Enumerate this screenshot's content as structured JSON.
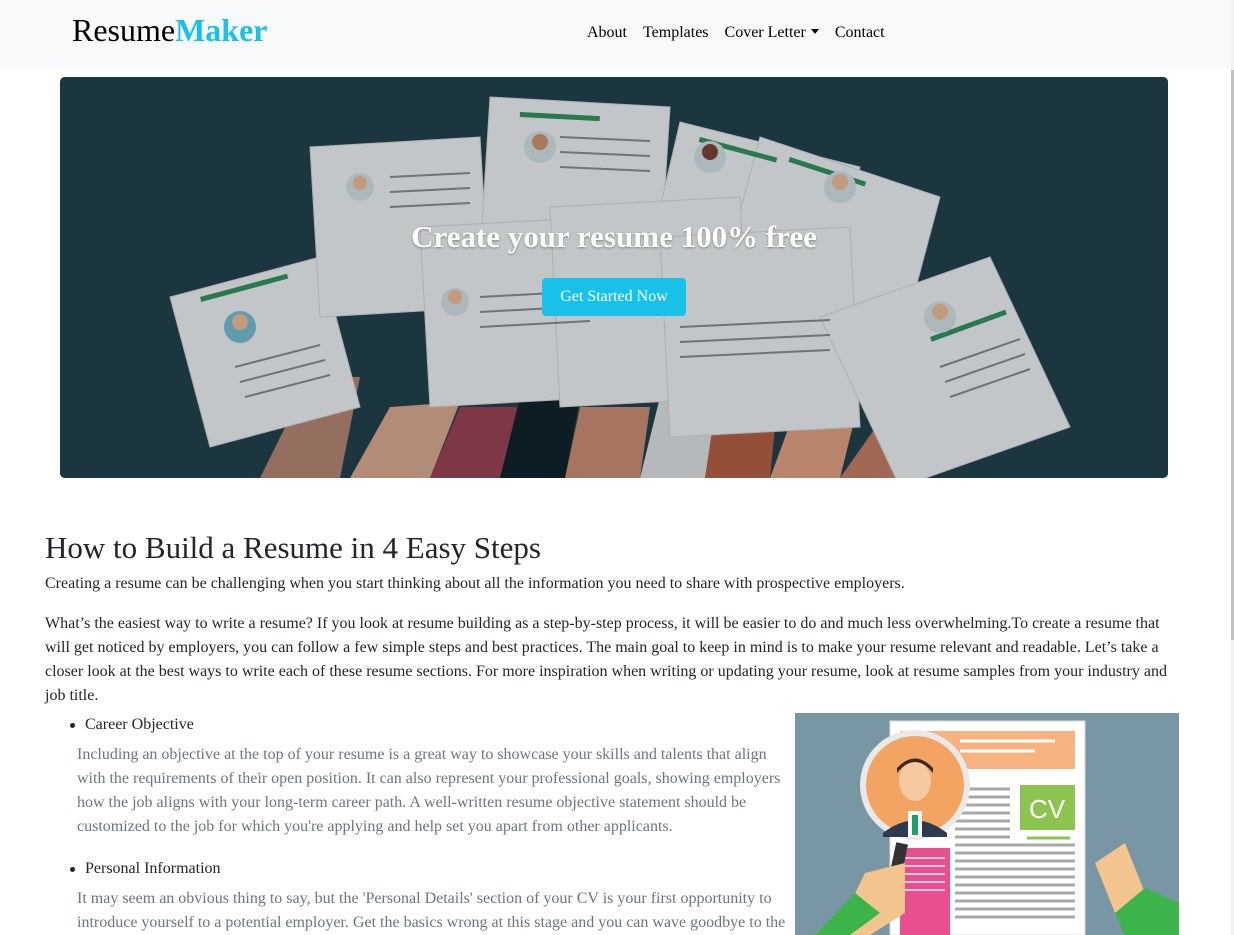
{
  "navbar": {
    "brand_part1": "Resume",
    "brand_part2": "Maker",
    "links": [
      {
        "label": "About"
      },
      {
        "label": "Templates"
      },
      {
        "label": "Cover Letter"
      },
      {
        "label": "Contact"
      }
    ],
    "brand_accent_color": "#17c1e8"
  },
  "hero": {
    "title": "Create your resume 100% free",
    "cta_label": "Get Started Now",
    "cta_color": "#17c1e8",
    "background_color": "#1e3a44"
  },
  "section": {
    "title": "How to Build a Resume in 4 Easy Steps",
    "intro": "Creating a resume can be challenging when you start thinking about all the information you need to share with prospective employers.",
    "body": "What’s the easiest way to write a resume? If you look at resume building as a step-by-step process, it will be easier to do and much less overwhelming.To create a resume that will get noticed by employers, you can follow a few simple steps and best practices. The main goal to keep in mind is to make your resume relevant and readable. Let’s take a closer look at the best ways to write each of these resume sections. For more inspiration when writing or updating your resume, look at resume samples from your industry and job title."
  },
  "steps": [
    {
      "title": "Career Objective",
      "text": "Including an objective at the top of your resume is a great way to showcase your skills and talents that align with the requirements of their open position. It can also represent your professional goals, showing employers how the job aligns with your long-term career path. A well-written resume objective statement should be customized to the job for which you're applying and help set you apart from other applicants."
    },
    {
      "title": "Personal Information",
      "text": "It may seem an obvious thing to say, but the 'Personal Details' section of your CV is your first opportunity to introduce yourself to a potential employer. Get the basics wrong at this stage and you can wave goodbye to the"
    }
  ],
  "illustration": {
    "badge_text": "CV"
  }
}
